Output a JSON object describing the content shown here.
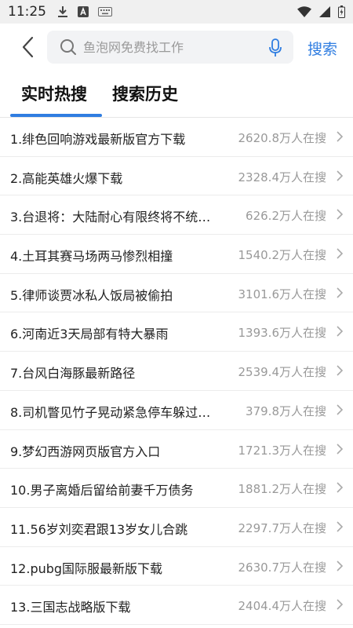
{
  "status_bar": {
    "time": "11:25",
    "icons": [
      "download-icon",
      "notification-a-icon",
      "keyboard-icon",
      "wifi-icon",
      "signal-icon",
      "battery-icon"
    ]
  },
  "search": {
    "placeholder": "鱼泡网免费找工作",
    "value": "",
    "button_label": "搜索"
  },
  "tabs": [
    {
      "label": "实时热搜",
      "active": true
    },
    {
      "label": "搜索历史",
      "active": false
    }
  ],
  "hot_list": [
    {
      "title": "1.绯色回响游戏最新版官方下载",
      "count": "2620.8万人在搜"
    },
    {
      "title": "2.高能英雄火爆下载",
      "count": "2328.4万人在搜"
    },
    {
      "title": "3.台退将：大陆耐心有限终将不统…",
      "count": "626.2万人在搜"
    },
    {
      "title": "4.土耳其赛马场两马惨烈相撞",
      "count": "1540.2万人在搜"
    },
    {
      "title": "5.律师谈贾冰私人饭局被偷拍",
      "count": "3101.6万人在搜"
    },
    {
      "title": "6.河南近3天局部有特大暴雨",
      "count": "1393.6万人在搜"
    },
    {
      "title": "7.台风白海豚最新路径",
      "count": "2539.4万人在搜"
    },
    {
      "title": "8.司机瞥见竹子晃动紧急停车躲过…",
      "count": "379.8万人在搜"
    },
    {
      "title": "9.梦幻西游网页版官方入口",
      "count": "1721.3万人在搜"
    },
    {
      "title": "10.男子离婚后留给前妻千万债务",
      "count": "1881.2万人在搜"
    },
    {
      "title": "11.56岁刘奕君跟13岁女儿合跳",
      "count": "2297.7万人在搜"
    },
    {
      "title": "12.pubg国际服最新版下载",
      "count": "2630.7万人在搜"
    },
    {
      "title": "13.三国志战略版下载",
      "count": "2404.4万人在搜"
    }
  ],
  "colors": {
    "accent": "#2f7de1",
    "text_primary": "#222222",
    "text_secondary": "#999999",
    "search_bg": "#f2f3f5"
  }
}
